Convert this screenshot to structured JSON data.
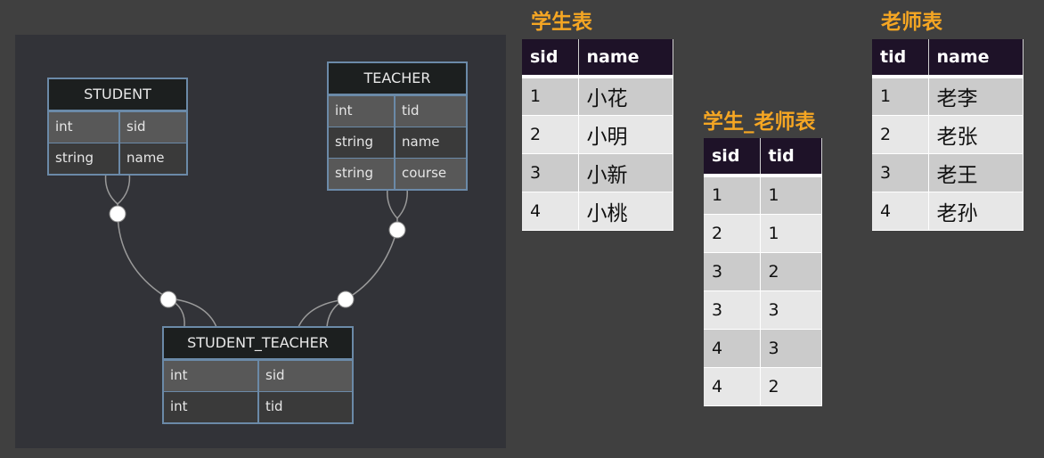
{
  "er": {
    "student": {
      "title": "STUDENT",
      "rows": [
        {
          "type": "int",
          "field": "sid"
        },
        {
          "type": "string",
          "field": "name"
        }
      ]
    },
    "teacher": {
      "title": "TEACHER",
      "rows": [
        {
          "type": "int",
          "field": "tid"
        },
        {
          "type": "string",
          "field": "name"
        },
        {
          "type": "string",
          "field": "course"
        }
      ]
    },
    "student_teacher": {
      "title": "STUDENT_TEACHER",
      "rows": [
        {
          "type": "int",
          "field": "sid"
        },
        {
          "type": "int",
          "field": "tid"
        }
      ]
    }
  },
  "tables": {
    "student": {
      "title": "学生表",
      "headers": [
        "sid",
        "name"
      ],
      "rows": [
        [
          "1",
          "小花"
        ],
        [
          "2",
          "小明"
        ],
        [
          "3",
          "小新"
        ],
        [
          "4",
          "小桃"
        ]
      ]
    },
    "student_teacher": {
      "title": "学生_老师表",
      "headers": [
        "sid",
        "tid"
      ],
      "rows": [
        [
          "1",
          "1"
        ],
        [
          "2",
          "1"
        ],
        [
          "3",
          "2"
        ],
        [
          "3",
          "3"
        ],
        [
          "4",
          "3"
        ],
        [
          "4",
          "2"
        ]
      ]
    },
    "teacher": {
      "title": "老师表",
      "headers": [
        "tid",
        "name"
      ],
      "rows": [
        [
          "1",
          "老李"
        ],
        [
          "2",
          "老张"
        ],
        [
          "3",
          "老王"
        ],
        [
          "4",
          "老孙"
        ]
      ]
    }
  }
}
